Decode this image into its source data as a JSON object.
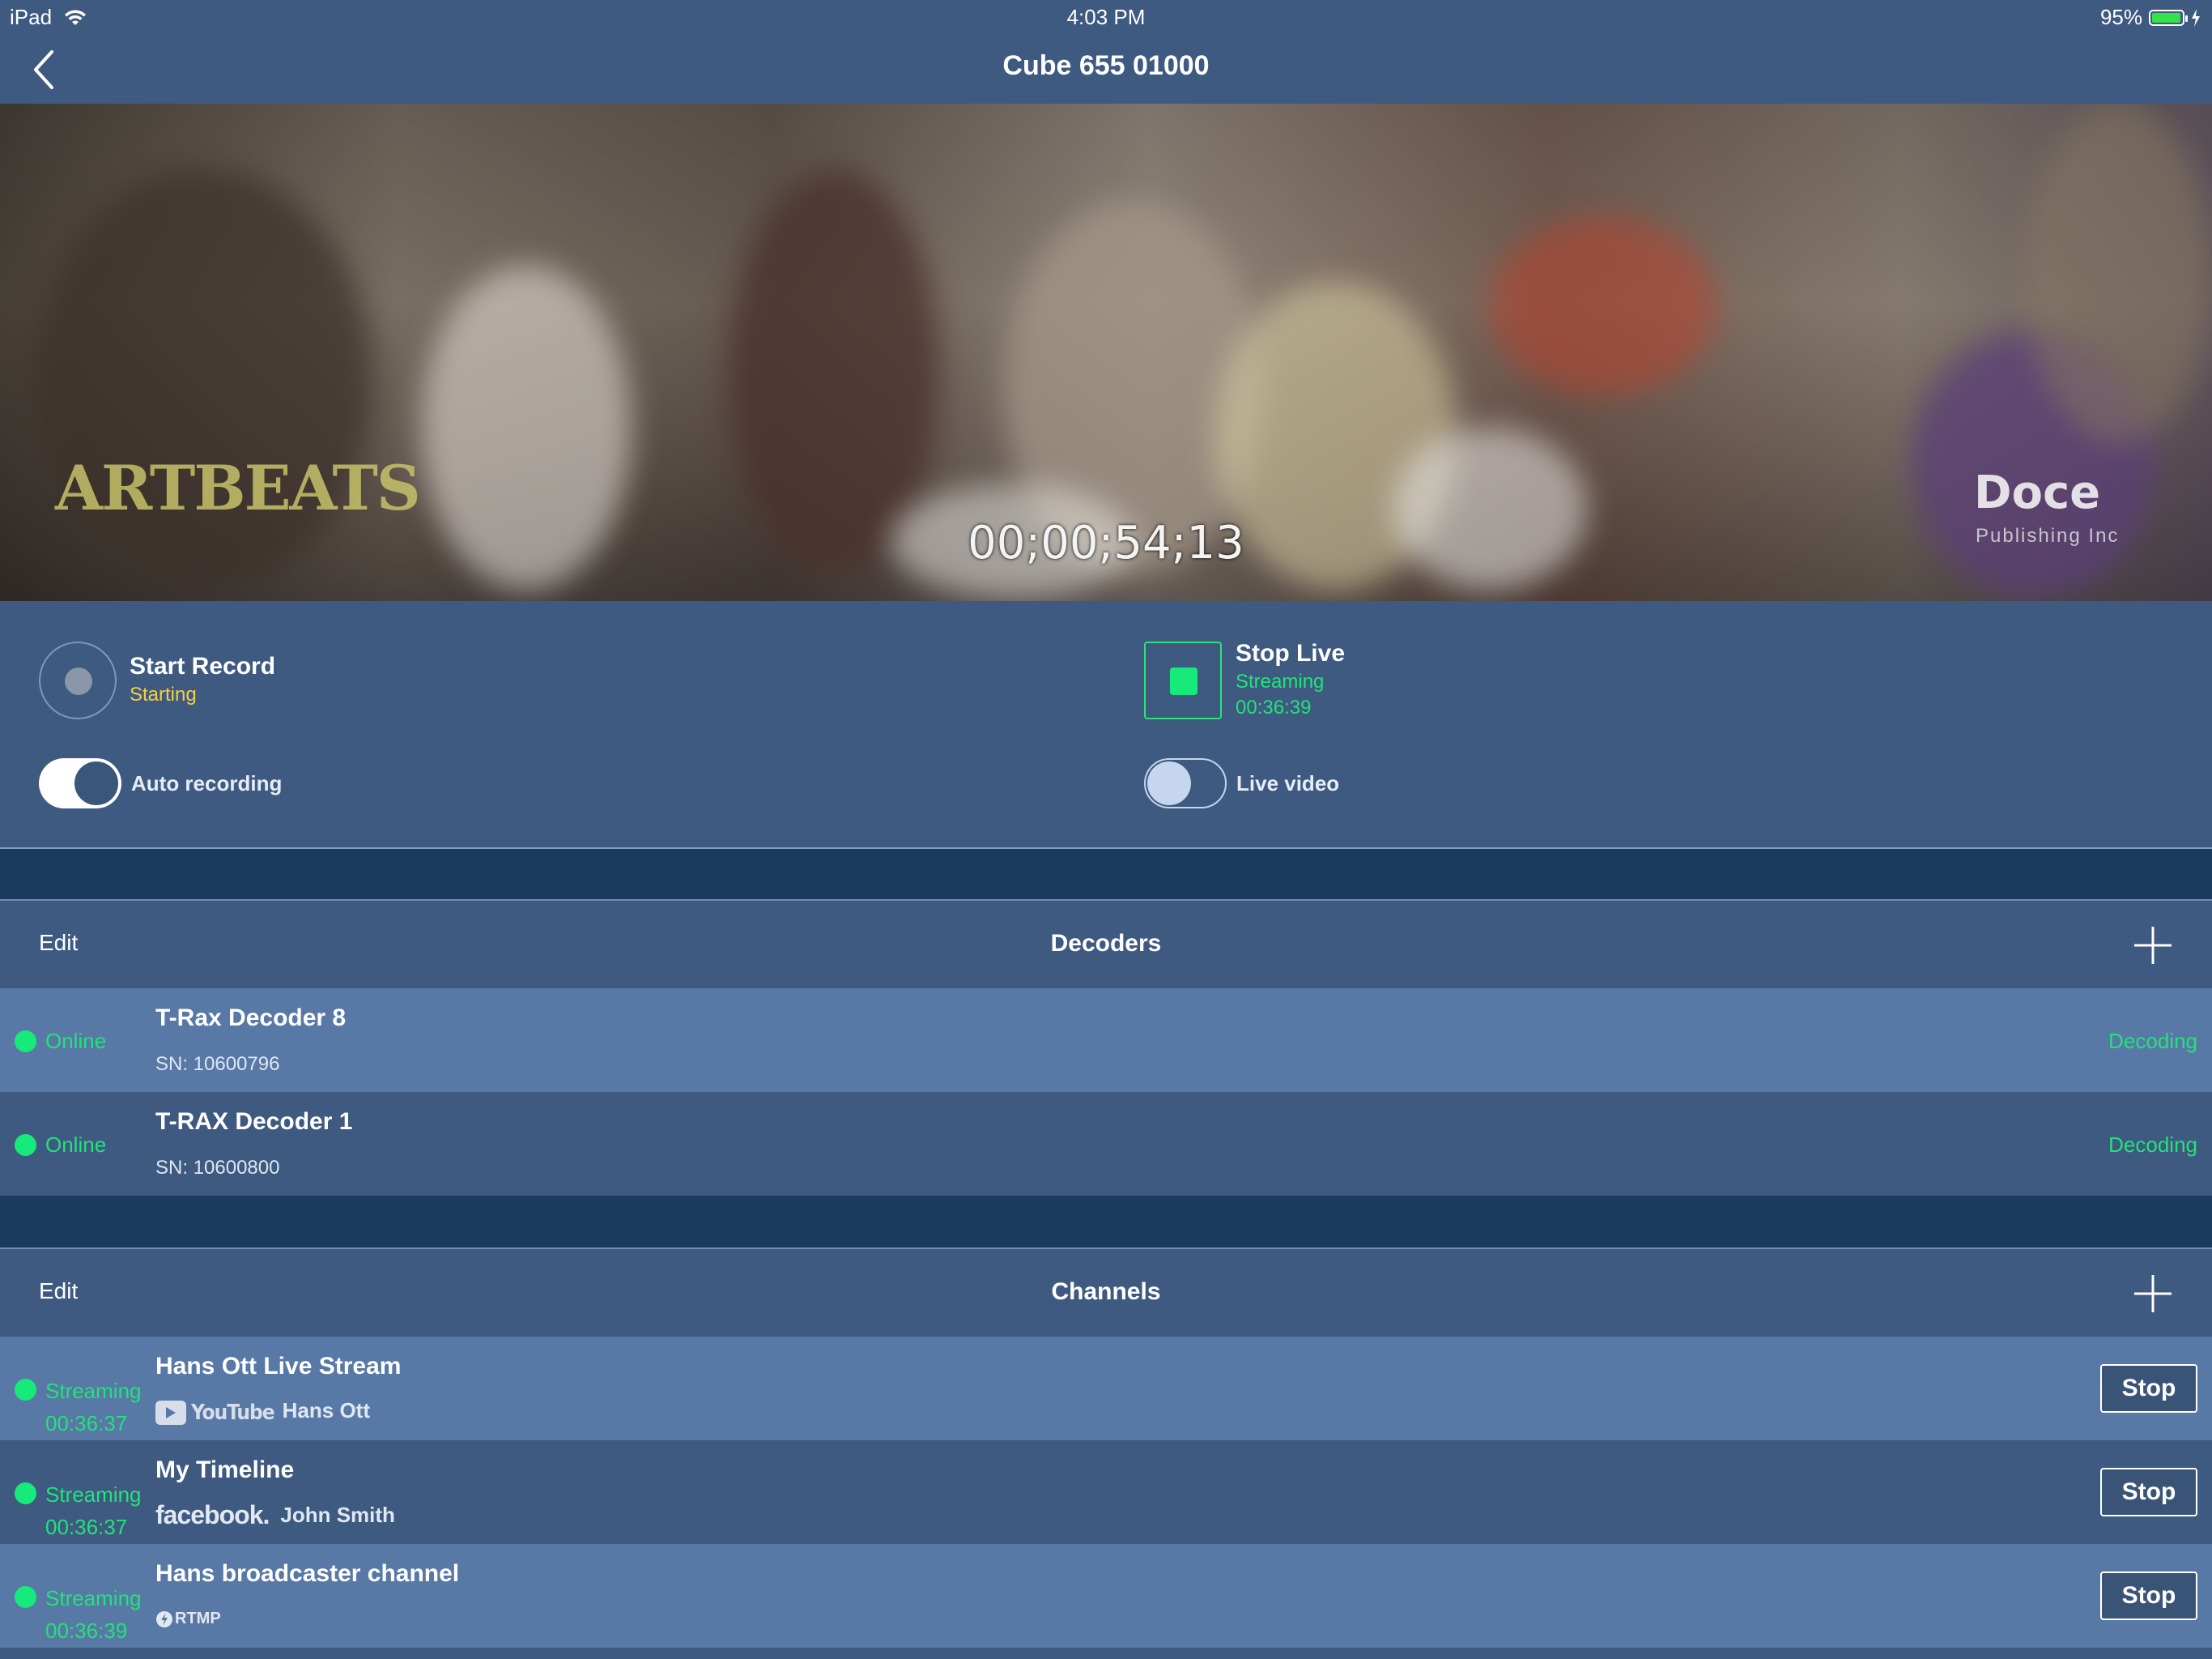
{
  "status_bar": {
    "device": "iPad",
    "time": "4:03 PM",
    "battery": "95%"
  },
  "nav": {
    "title": "Cube 655 01000"
  },
  "video": {
    "timecode": "00;00;54;13",
    "overlay_left": "ARTBEATS",
    "overlay_right": "Doce",
    "overlay_right_sub": "Publishing Inc"
  },
  "controls": {
    "record": {
      "label": "Start Record",
      "status": "Starting",
      "status_color": "#f4d03f"
    },
    "live": {
      "label": "Stop Live",
      "status": "Streaming",
      "duration": "00:36:39",
      "status_color": "#22e27a"
    },
    "auto_recording": {
      "label": "Auto recording",
      "on": true
    },
    "live_video": {
      "label": "Live video",
      "on": false
    }
  },
  "decoders": {
    "edit_label": "Edit",
    "title": "Decoders",
    "items": [
      {
        "status": "Online",
        "name": "T-Rax Decoder 8",
        "sn": "SN: 10600796",
        "state": "Decoding"
      },
      {
        "status": "Online",
        "name": "T-RAX Decoder 1",
        "sn": "SN: 10600800",
        "state": "Decoding"
      }
    ]
  },
  "channels": {
    "edit_label": "Edit",
    "title": "Channels",
    "items": [
      {
        "status": "Streaming",
        "duration": "00:36:37",
        "name": "Hans Ott Live Stream",
        "platform": "YouTube",
        "account": "Hans Ott",
        "action": "Stop"
      },
      {
        "status": "Streaming",
        "duration": "00:36:37",
        "name": "My Timeline",
        "platform": "facebook.",
        "account": "John Smith",
        "action": "Stop"
      },
      {
        "status": "Streaming",
        "duration": "00:36:39",
        "name": "Hans broadcaster channel",
        "platform": "RTMP",
        "account": "",
        "action": "Stop"
      }
    ]
  },
  "colors": {
    "background": "#3e5a80",
    "row_light": "#5879a6",
    "band": "#1b3a5e",
    "accent_green": "#22e27a",
    "accent_yellow": "#f4d03f"
  }
}
